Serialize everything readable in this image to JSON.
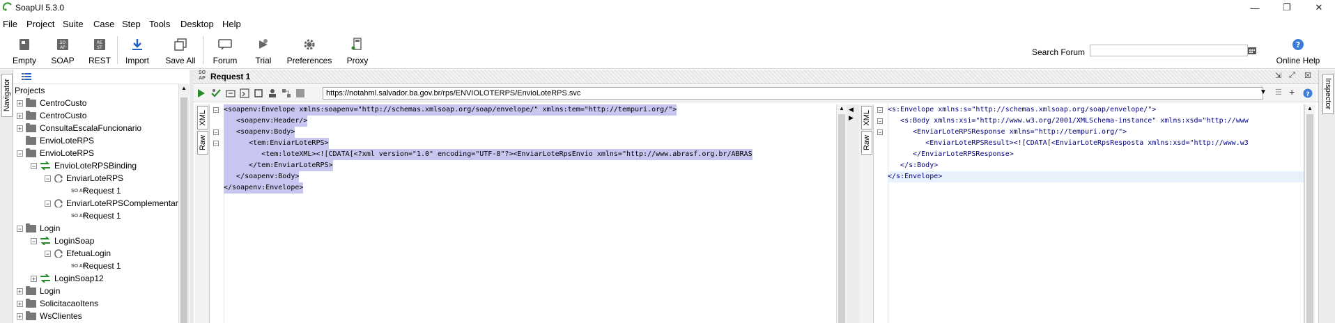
{
  "window": {
    "title": "SoapUI 5.3.0",
    "minimize": "—",
    "maximize": "❐",
    "close": "✕"
  },
  "menu": [
    "File",
    "Project",
    "Suite",
    "Case",
    "Step",
    "Tools",
    "Desktop",
    "Help"
  ],
  "toolbar": {
    "buttons": [
      "Empty",
      "SOAP",
      "REST",
      "Import",
      "Save All",
      "Forum",
      "Trial",
      "Preferences",
      "Proxy"
    ],
    "search_label": "Search Forum",
    "search_value": "",
    "online_help": "Online Help"
  },
  "navigator": {
    "tab_label": "Navigator",
    "root": "Projects",
    "items": [
      {
        "label": "CentroCusto"
      },
      {
        "label": "CentroCusto"
      },
      {
        "label": "ConsultaEscalaFuncionario"
      },
      {
        "label": "EnvioLoteRPS"
      },
      {
        "label": "EnvioLoteRPS"
      },
      {
        "label": "EnvioLoteRPSBinding"
      },
      {
        "label": "EnviarLoteRPS"
      },
      {
        "label": "Request 1"
      },
      {
        "label": "EnviarLoteRPSComplementar"
      },
      {
        "label": "Request 1"
      },
      {
        "label": "Login"
      },
      {
        "label": "LoginSoap"
      },
      {
        "label": "EfetuaLogin"
      },
      {
        "label": "Request 1"
      },
      {
        "label": "LoginSoap12"
      },
      {
        "label": "Login"
      },
      {
        "label": "SolicitacaoItens"
      },
      {
        "label": "WsClientes"
      }
    ],
    "soap_badge": "SO AP"
  },
  "request": {
    "title": "Request 1",
    "badge": "SO AP",
    "url": "https://notahml.salvador.ba.gov.br/rps/ENVIOLOTERPS/EnvioLoteRPS.svc",
    "tabs": [
      "XML",
      "Raw"
    ],
    "lines": [
      "<soapenv:Envelope xmlns:soapenv=\"http://schemas.xmlsoap.org/soap/envelope/\" xmlns:tem=\"http://tempuri.org/\">",
      "   <soapenv:Header/>",
      "   <soapenv:Body>",
      "      <tem:EnviarLoteRPS>",
      "         <tem:loteXML><![CDATA[<?xml version=\"1.0\" encoding=\"UTF-8\"?><EnviarLoteRpsEnvio xmlns=\"http://www.abrasf.org.br/ABRAS",
      "      </tem:EnviarLoteRPS>",
      "   </soapenv:Body>",
      "</soapenv:Envelope>"
    ]
  },
  "response": {
    "tabs": [
      "XML",
      "Raw"
    ],
    "lines": [
      "<s:Envelope xmlns:s=\"http://schemas.xmlsoap.org/soap/envelope/\">",
      "   <s:Body xmlns:xsi=\"http://www.w3.org/2001/XMLSchema-instance\" xmlns:xsd=\"http://www",
      "      <EnviarLoteRPSResponse xmlns=\"http://tempuri.org/\">",
      "         <EnviarLoteRPSResult><![CDATA[<EnviarLoteRpsResposta xmlns:xsd=\"http://www.w3",
      "      </EnviarLoteRPSResponse>",
      "   </s:Body>",
      "</s:Envelope>"
    ]
  },
  "inspector": {
    "tab_label": "Inspector"
  },
  "colors": {
    "accent": "#2a8a2a",
    "selection": "#c6c6f0",
    "help": "#3b7dd8"
  }
}
